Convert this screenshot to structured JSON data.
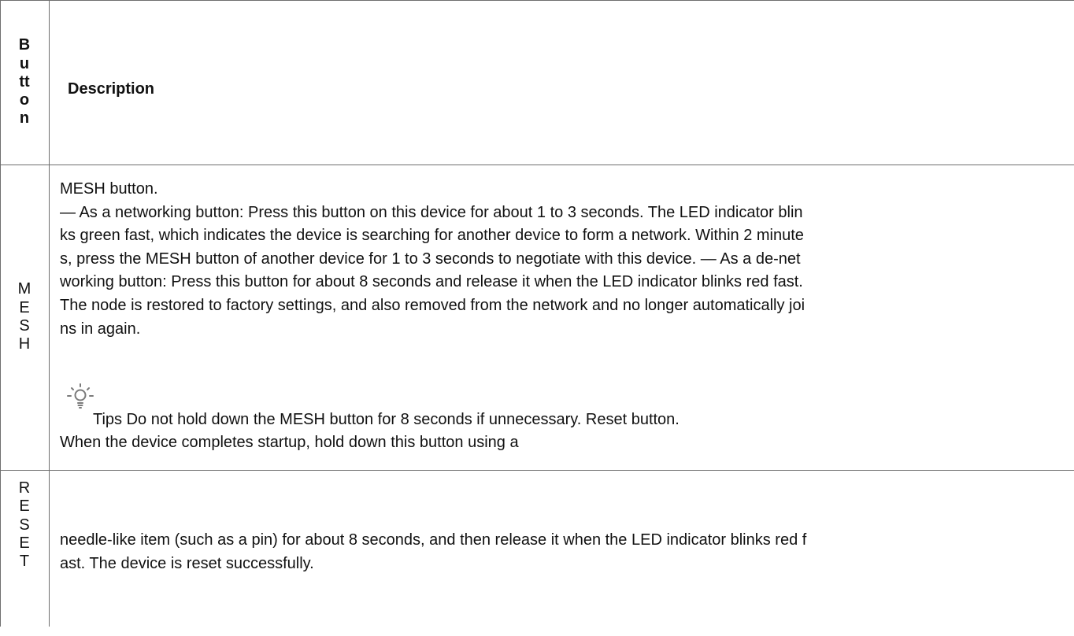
{
  "table": {
    "header": {
      "button_letters": [
        "B",
        "u",
        "tt",
        "o",
        "n"
      ],
      "description": "Description"
    },
    "rows": [
      {
        "button_letters": [
          "M",
          "E",
          "S",
          "H"
        ],
        "description_lines": [
          "MESH button.",
          "— As a networking button: Press this button on this device for about 1 to 3 seconds. The LED indicator blin",
          "ks green fast, which indicates the device is searching for another device to form a network. Within 2 minute",
          "s, press the MESH button of another device for 1 to 3 seconds to negotiate with this device. — As a de-net",
          "working button: Press this button for about 8 seconds and release it  when the LED indicator blinks red fast.",
          "The node is restored to factory settings, and also removed from the network and no longer  automatically joi",
          "ns in again."
        ],
        "tips_icon": "lightbulb-icon",
        "tips_text": "Tips Do not hold down the MESH button for 8 seconds if unnecessary. Reset button.",
        "last_line": "When the device completes startup, hold down this button using a"
      },
      {
        "button_letters": [
          "R",
          "E",
          "S",
          "E",
          "T"
        ],
        "description_lines": [
          "needle-like item (such as a pin) for about 8 seconds, and then release it when the LED indicator blinks red f",
          "ast. The device is reset successfully."
        ]
      }
    ]
  }
}
